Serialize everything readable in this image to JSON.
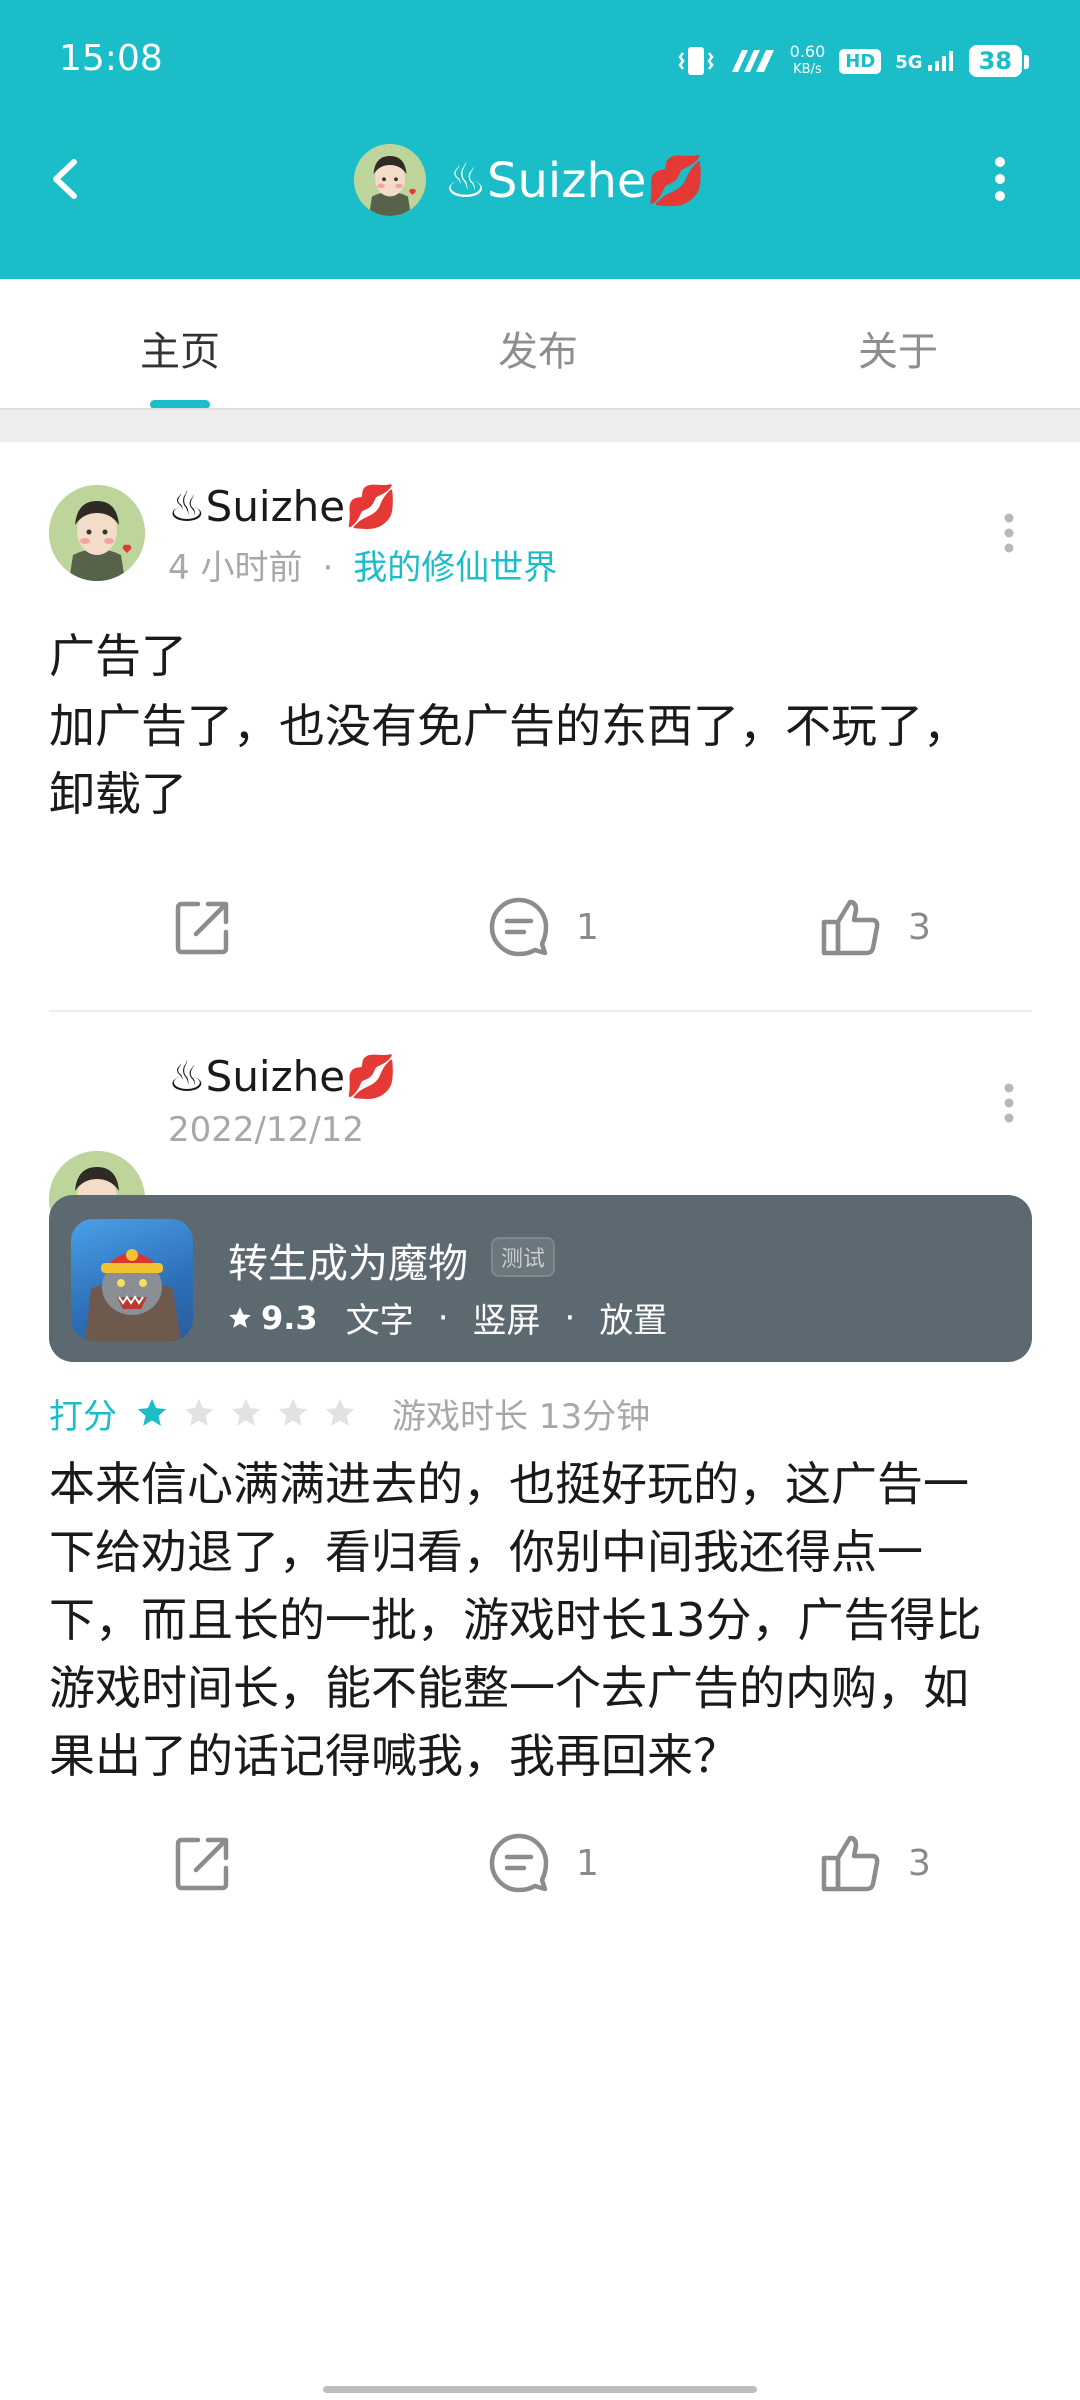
{
  "status_bar": {
    "time": "15:08",
    "net_speed_value": "0.60",
    "net_speed_unit": "KB/s",
    "hd": "HD",
    "network": "5G",
    "battery": "38"
  },
  "nav": {
    "title": "♨Suizhe💋",
    "accent_color": "#1bbdc8"
  },
  "tabs": [
    {
      "label": "主页",
      "active": true
    },
    {
      "label": "发布",
      "active": false
    },
    {
      "label": "关于",
      "active": false
    }
  ],
  "posts": [
    {
      "author": "♨Suizhe💋",
      "time": "4 小时前",
      "separator": "·",
      "tag": "我的修仙世界",
      "title": "广告了",
      "body_lines": [
        "加广告了，也没有免广告的东西了，不玩了，",
        "卸载了"
      ],
      "comments": "1",
      "likes": "3"
    },
    {
      "author": "♨Suizhe💋",
      "date": "2022/12/12",
      "game": {
        "name": "转生成为魔物",
        "badge": "测试",
        "score": "9.3",
        "tags": [
          "文字",
          "竖屏",
          "放置"
        ],
        "tag_separator": "·"
      },
      "rating_label": "打分",
      "rating": 0.2,
      "stars_filled": 1,
      "stars_total": 5,
      "playtime": "游戏时长 13分钟",
      "body_lines": [
        "本来信心满满进去的，也挺好玩的，这广告一",
        "下给劝退了，看归看，你别中间我还得点一",
        "下，而且长的一批，游戏时长13分，广告得比",
        "游戏时间长，能不能整一个去广告的内购，如",
        "果出了的话记得喊我，我再回来？"
      ],
      "comments": "1",
      "likes": "3"
    }
  ],
  "icons": [
    "back-arrow-icon",
    "more-vertical-icon",
    "share-icon",
    "comment-icon",
    "thumbs-up-icon",
    "star-icon",
    "vibrate-icon",
    "signal-icon"
  ]
}
